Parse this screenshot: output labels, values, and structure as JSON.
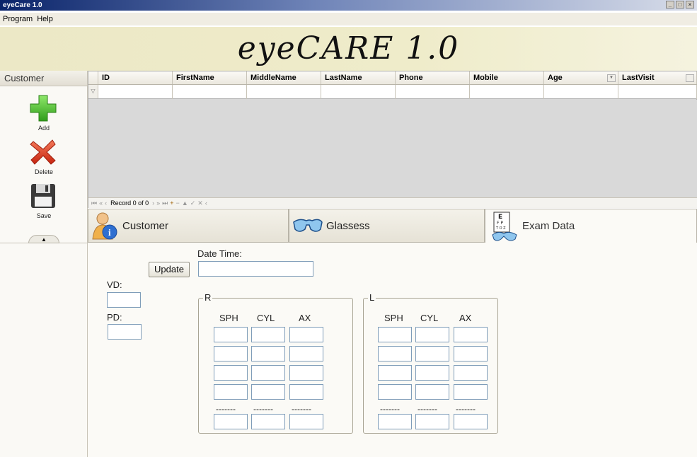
{
  "window": {
    "title": "eyeCare 1.0"
  },
  "menu": {
    "items": [
      "Program",
      "Help"
    ]
  },
  "banner": {
    "title": "eyeCARE 1.0"
  },
  "sidebar": {
    "header": "Customer",
    "buttons": [
      {
        "label": "Add",
        "icon": "plus-icon",
        "color": "#3cb521"
      },
      {
        "label": "Delete",
        "icon": "x-icon",
        "color": "#d9331c"
      },
      {
        "label": "Save",
        "icon": "floppy-disk-icon",
        "color": "#333333"
      }
    ]
  },
  "grid": {
    "columns": [
      "ID",
      "FirstName",
      "MiddleName",
      "LastName",
      "Phone",
      "Mobile",
      "Age",
      "LastVisit"
    ],
    "record_text": "Record 0 of 0"
  },
  "tabs": [
    {
      "label": "Customer",
      "icon": "customer-info-icon"
    },
    {
      "label": "Glassess",
      "icon": "glasses-icon"
    },
    {
      "label": "Exam Data",
      "icon": "eye-chart-icon",
      "active": true
    }
  ],
  "exam": {
    "update_label": "Update",
    "datetime_label": "Date Time:",
    "vd_label": "VD:",
    "pd_label": "PD:",
    "right": {
      "title": "R",
      "headers": [
        "SPH",
        "CYL",
        "AX"
      ],
      "separator": "-------"
    },
    "left": {
      "title": "L",
      "headers": [
        "SPH",
        "CYL",
        "AX"
      ],
      "separator": "-------"
    }
  }
}
